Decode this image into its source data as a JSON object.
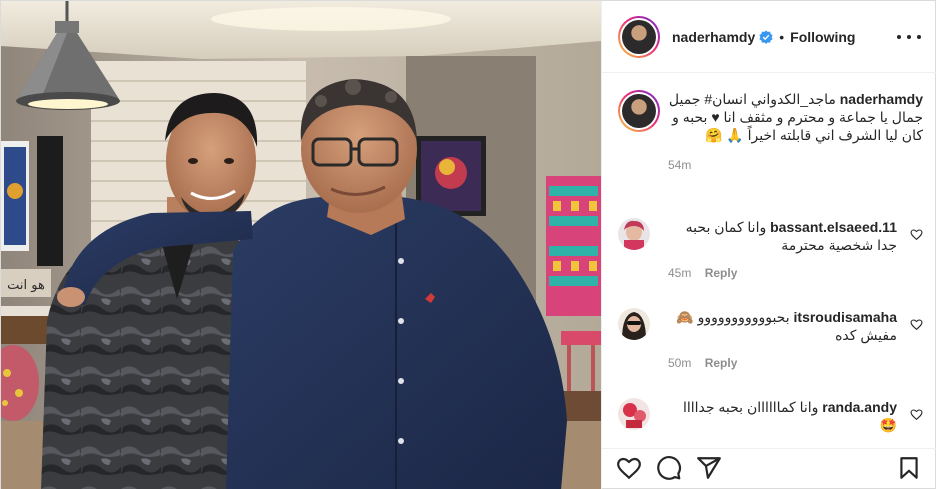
{
  "post": {
    "author": {
      "username": "naderhamdy",
      "verified": true,
      "follow_status": "Following",
      "separator": "•"
    },
    "menu_icon": "more-horizontal-icon",
    "caption": {
      "username": "naderhamdy",
      "text": "ماجد_الكدواني انسان# جميل جمال يا جماعة و محترم و مثقف انا ♥ بحبه و كان ليا الشرف اني قابلته اخيراً 🙏 🤗",
      "time": "54m"
    },
    "comments": [
      {
        "username": "bassant.elsaeed.11",
        "text": "وانا كمان بحبه جدا شخصية محترمة",
        "time": "45m",
        "reply_label": "Reply",
        "like_icon": "heart-outline-icon"
      },
      {
        "username": "itsroudisamaha",
        "text": "بحبووووووووووو 🙈 مفيش كده",
        "time": "50m",
        "reply_label": "Reply",
        "like_icon": "heart-outline-icon"
      },
      {
        "username": "randa.andy",
        "text": "وانا كماااااان بحبه جداااا 🤩",
        "time": "",
        "reply_label": "",
        "like_icon": "heart-outline-icon"
      }
    ],
    "actions": [
      {
        "name": "like-button",
        "icon": "heart-outline-icon"
      },
      {
        "name": "comment-button",
        "icon": "comment-icon"
      },
      {
        "name": "share-button",
        "icon": "paper-plane-icon"
      },
      {
        "name": "save-button",
        "icon": "bookmark-icon"
      }
    ],
    "photo": {
      "wall_sign_text": "هو انت"
    }
  }
}
